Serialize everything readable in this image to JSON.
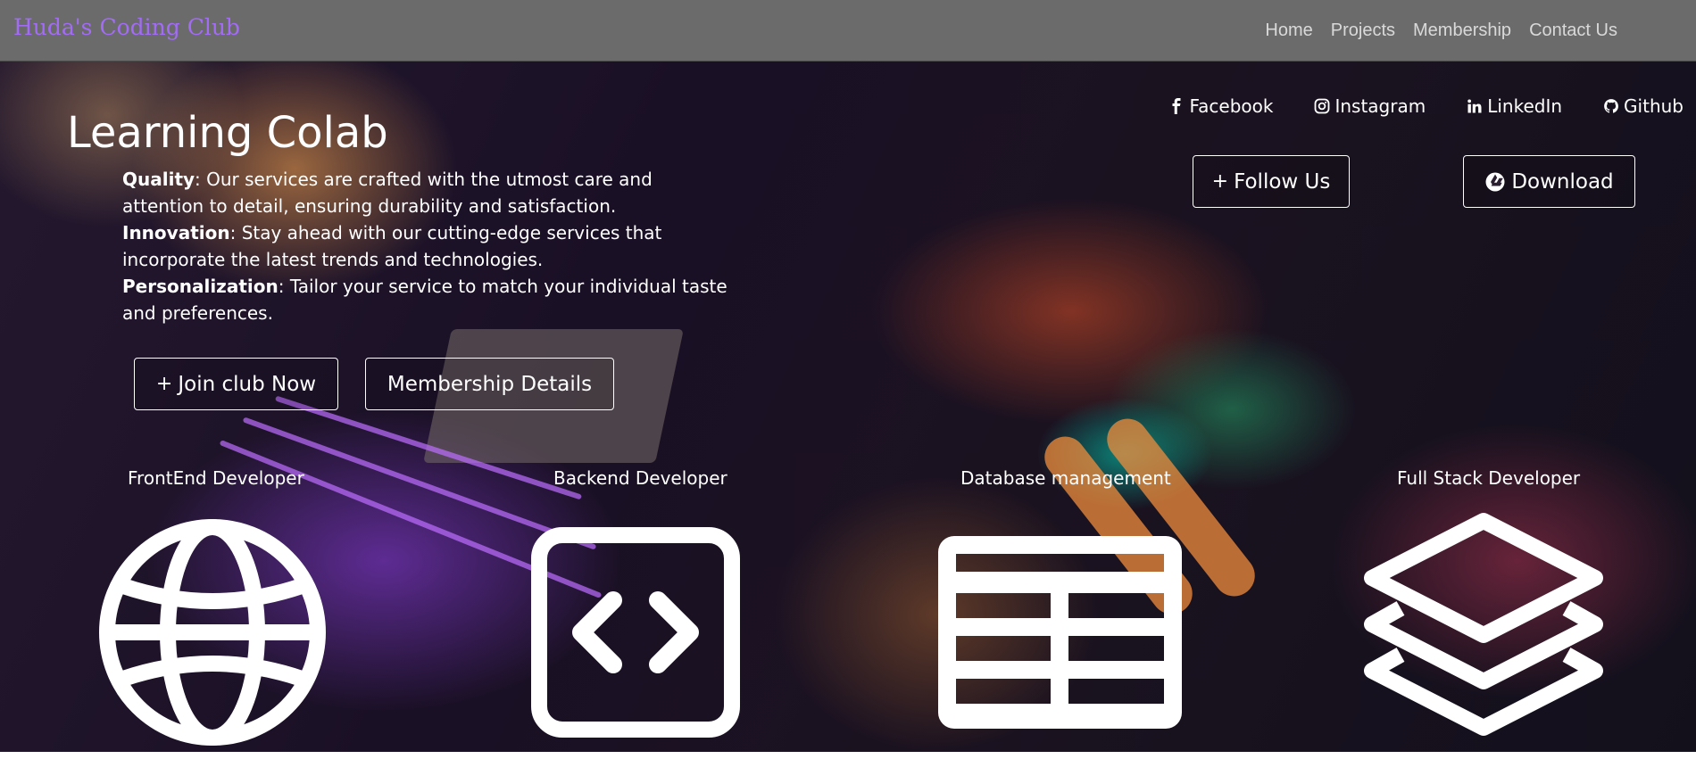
{
  "navbar": {
    "brand": "Huda's Coding Club",
    "links": [
      {
        "label": "Home"
      },
      {
        "label": "Projects"
      },
      {
        "label": "Membership"
      },
      {
        "label": "Contact Us"
      }
    ]
  },
  "hero": {
    "title": "Learning Colab",
    "features": [
      {
        "label": "Quality",
        "text": ": Our services are crafted with the utmost care and attention to detail, ensuring durability and satisfaction."
      },
      {
        "label": "Innovation",
        "text": ": Stay ahead with our cutting-edge services that incorporate the latest trends and technologies."
      },
      {
        "label": "Personalization",
        "text": ": Tailor your service to match your individual taste and preferences."
      }
    ],
    "join_button": {
      "icon": "plus-icon",
      "label": "Join club Now"
    },
    "membership_button": {
      "label": "Membership Details"
    },
    "follow_button": {
      "icon": "plus-icon",
      "label": "Follow Us"
    },
    "download_button": {
      "icon": "google-drive-icon",
      "label": "Download"
    }
  },
  "social": [
    {
      "icon": "facebook-icon",
      "label": "Facebook"
    },
    {
      "icon": "instagram-icon",
      "label": "Instagram"
    },
    {
      "icon": "linkedin-icon",
      "label": "LinkedIn"
    },
    {
      "icon": "github-icon",
      "label": "Github"
    }
  ],
  "roles": [
    {
      "title": "FrontEnd Developer",
      "icon": "globe-icon"
    },
    {
      "title": "Backend Developer",
      "icon": "code-window-icon"
    },
    {
      "title": "Database management",
      "icon": "table-icon"
    },
    {
      "title": "Full Stack Developer",
      "icon": "layers-icon"
    }
  ],
  "colors": {
    "navbar_bg": "#6b6b6b",
    "brand": "#a26cf5",
    "nav_link": "#d9d9d9",
    "text": "#ffffff"
  }
}
